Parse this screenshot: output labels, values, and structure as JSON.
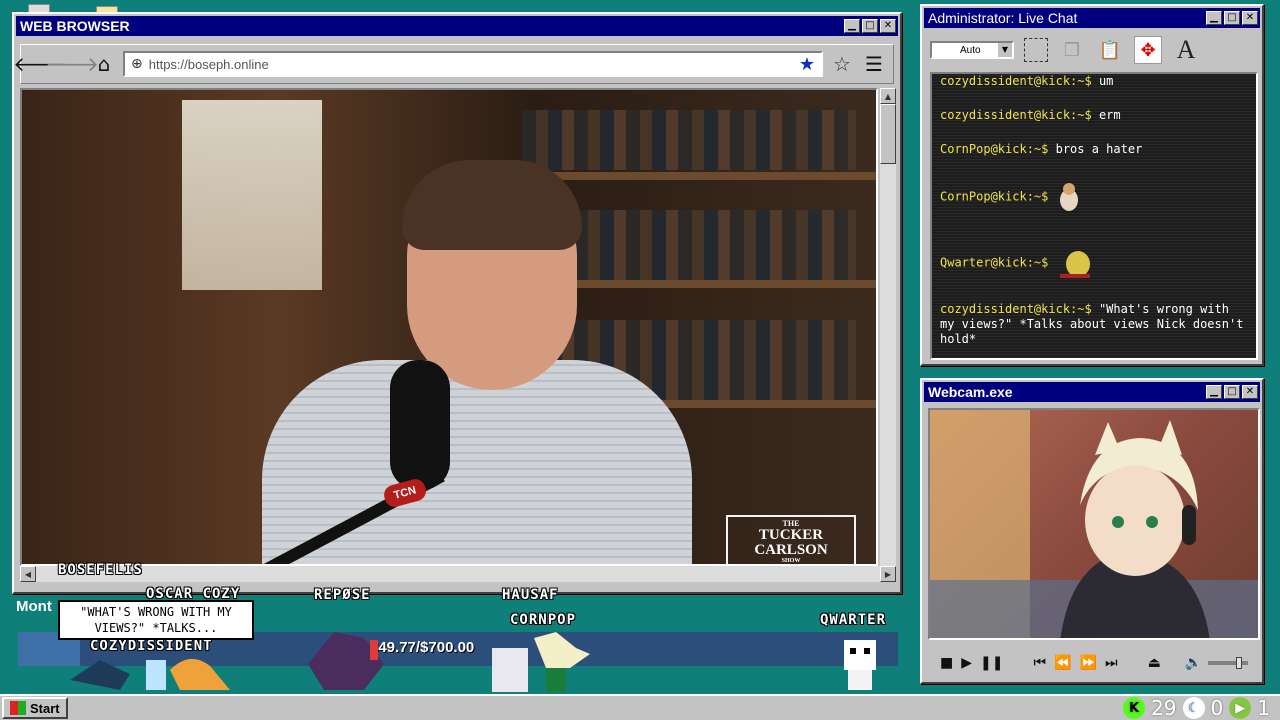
{
  "browser": {
    "title": "WEB BROWSER",
    "url": "https://boseph.online"
  },
  "chat": {
    "title": "Administrator: Live Chat",
    "font_size_select": "Auto",
    "messages": [
      {
        "user": "cozydissident@kick:~$",
        "text": " um"
      },
      {
        "user": "cozydissident@kick:~$",
        "text": " erm"
      },
      {
        "user": "CornPop@kick:~$",
        "text": " bros a hater"
      },
      {
        "user": "CornPop@kick:~$",
        "text": ""
      },
      {
        "user": "Qwarter@kick:~$",
        "text": ""
      },
      {
        "user": "cozydissident@kick:~$",
        "text": " \"What's wrong with my views?\" *Talks about views Nick doesn't hold*"
      }
    ]
  },
  "webcam": {
    "title": "Webcam.exe"
  },
  "video": {
    "logo_line1": "THE",
    "logo_line2": "TUCKER",
    "logo_line3": "CARLSON",
    "logo_line4": "SHOW",
    "mic_badge": "TCN"
  },
  "overlay": {
    "names": {
      "bosefelis": "BOSEFELIS",
      "oscar": "OSCAR COZY",
      "repose": "REPØSE",
      "hausaf": "HAUSAF",
      "cornpop": "CORNPOP",
      "qwarter": "QWARTER",
      "cozy": "COZYDISSIDENT"
    },
    "bubble": "\"WHAT'S WRONG WITH MY VIEWS?\" *TALKS...",
    "goal_label": "Mont",
    "goal_text": "$49.77/$700.00",
    "goal_fraction": 0.071
  },
  "taskbar": {
    "start_label": "Start",
    "stat1": "29",
    "stat2": "0",
    "stat3": "1"
  },
  "colors": {
    "desktop": "#0f7f7a",
    "titlebar": "#00007f",
    "chat_user": "#f0e24a"
  }
}
